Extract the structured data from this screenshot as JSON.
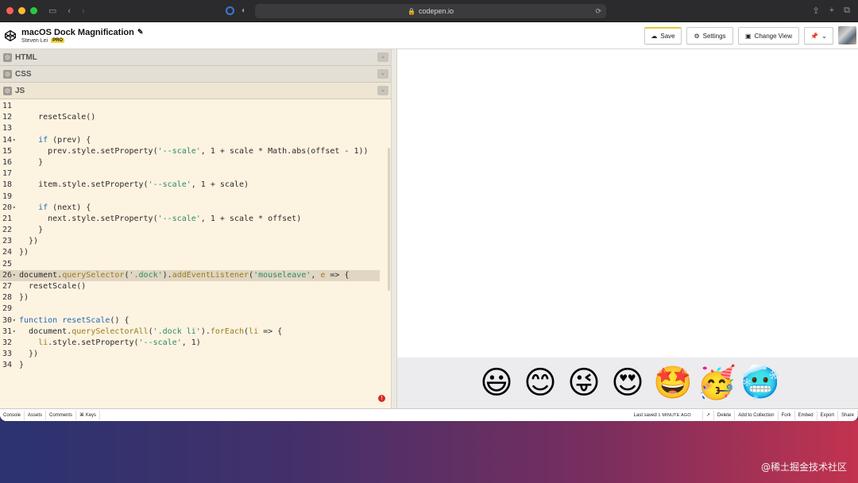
{
  "browser": {
    "url": "codepen.io",
    "traffic_lights": [
      "#ff5f57",
      "#febc2e",
      "#28c840"
    ]
  },
  "pen": {
    "title": "macOS Dock Magnification",
    "author": "Steven Lei",
    "badge": "PRO"
  },
  "header_buttons": {
    "save": "Save",
    "settings": "Settings",
    "change_view": "Change View"
  },
  "panels": {
    "html": "HTML",
    "css": "CSS",
    "js": "JS"
  },
  "code_lines": [
    {
      "n": "11",
      "fold": false,
      "hl": false,
      "html": ""
    },
    {
      "n": "12",
      "fold": false,
      "hl": false,
      "html": "    resetScale()"
    },
    {
      "n": "13",
      "fold": false,
      "hl": false,
      "html": ""
    },
    {
      "n": "14",
      "fold": true,
      "hl": false,
      "html": "    <span class=\"kw\">if</span> (prev) {"
    },
    {
      "n": "15",
      "fold": false,
      "hl": false,
      "html": "      prev.style.setProperty(<span class=\"str\">'--scale'</span>, 1 + scale * Math.abs(offset - 1))"
    },
    {
      "n": "16",
      "fold": false,
      "hl": false,
      "html": "    }"
    },
    {
      "n": "17",
      "fold": false,
      "hl": false,
      "html": ""
    },
    {
      "n": "18",
      "fold": false,
      "hl": false,
      "html": "    item.style.setProperty(<span class=\"str\">'--scale'</span>, 1 + scale)"
    },
    {
      "n": "19",
      "fold": false,
      "hl": false,
      "html": ""
    },
    {
      "n": "20",
      "fold": true,
      "hl": false,
      "html": "    <span class=\"kw\">if</span> (next) {"
    },
    {
      "n": "21",
      "fold": false,
      "hl": false,
      "html": "      next.style.setProperty(<span class=\"str\">'--scale'</span>, 1 + scale * offset)"
    },
    {
      "n": "22",
      "fold": false,
      "hl": false,
      "html": "    }"
    },
    {
      "n": "23",
      "fold": false,
      "hl": false,
      "html": "  })"
    },
    {
      "n": "24",
      "fold": false,
      "hl": false,
      "html": "})"
    },
    {
      "n": "25",
      "fold": false,
      "hl": false,
      "html": ""
    },
    {
      "n": "26",
      "fold": true,
      "hl": true,
      "html": "document.<span class=\"fn\">querySelector</span>(<span class=\"str\">'.dock'</span>).<span class=\"fn\">addEventListener</span>(<span class=\"str\">'mouseleave'</span>, <span class=\"fn\">e</span> => {"
    },
    {
      "n": "27",
      "fold": false,
      "hl": false,
      "html": "  resetScale()"
    },
    {
      "n": "28",
      "fold": false,
      "hl": false,
      "html": "})"
    },
    {
      "n": "29",
      "fold": false,
      "hl": false,
      "html": ""
    },
    {
      "n": "30",
      "fold": true,
      "hl": false,
      "html": "<span class=\"kw\">function</span> <span class=\"kw\">resetScale</span>() {"
    },
    {
      "n": "31",
      "fold": true,
      "hl": false,
      "html": "  document.<span class=\"fn\">querySelectorAll</span>(<span class=\"str\">'.dock li'</span>).<span class=\"fn\">forEach</span>(<span class=\"fn\">li</span> => {"
    },
    {
      "n": "32",
      "fold": false,
      "hl": false,
      "html": "    <span class=\"fn\">li</span>.style.setProperty(<span class=\"str\">'--scale'</span>, 1)"
    },
    {
      "n": "33",
      "fold": false,
      "hl": false,
      "html": "  })"
    },
    {
      "n": "34",
      "fold": false,
      "hl": false,
      "html": "}"
    }
  ],
  "dock_emojis": [
    "😃",
    "😊",
    "😜",
    "😍",
    "🤩",
    "🥳",
    "🥶"
  ],
  "footer": {
    "left": [
      "Console",
      "Assets",
      "Comments",
      "⌘ Keys"
    ],
    "saved_prefix": "Last saved",
    "saved_time": "1 MINUTE AGO",
    "right": [
      "Delete",
      "Add to Collection",
      "Fork",
      "Embed",
      "Export",
      "Share"
    ]
  },
  "watermark": "@稀土掘金技术社区"
}
